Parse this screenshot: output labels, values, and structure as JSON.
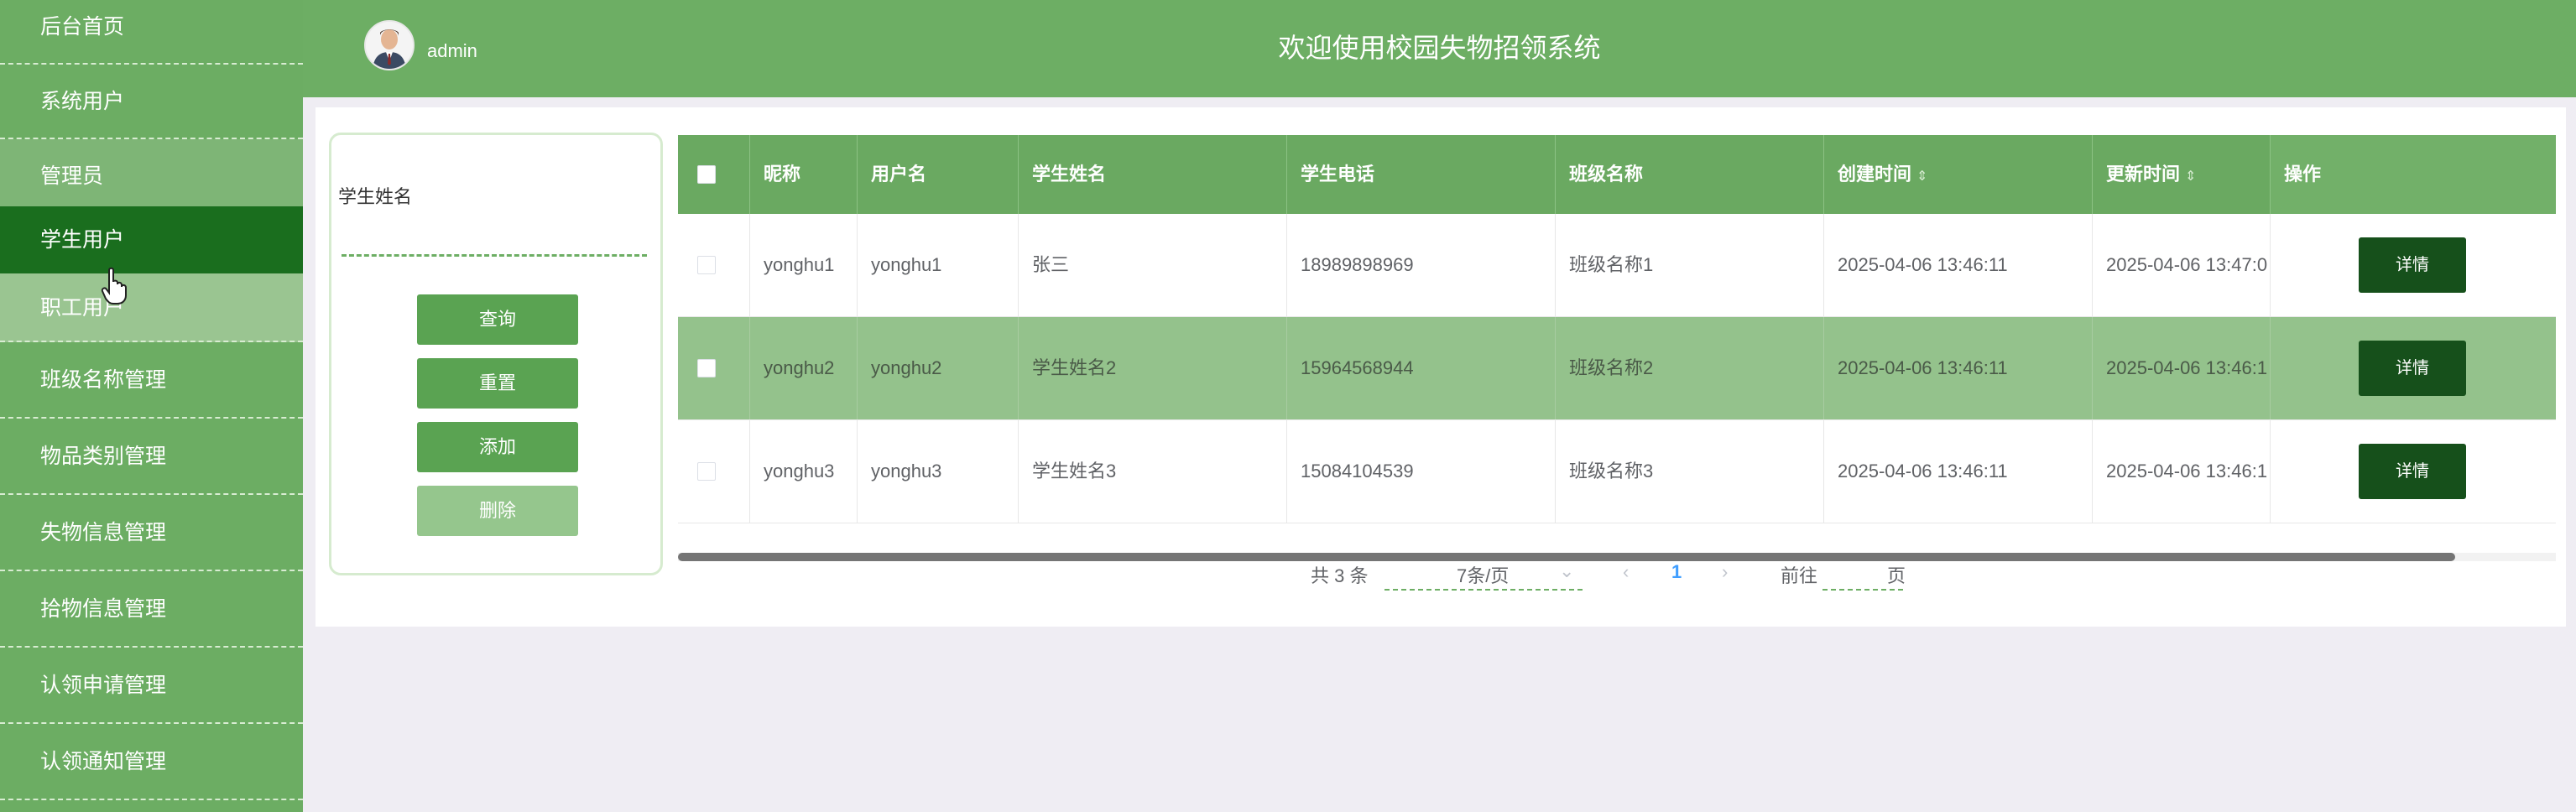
{
  "sidebar": {
    "items": [
      {
        "label": "后台首页"
      },
      {
        "label": "系统用户"
      },
      {
        "label": "管理员"
      },
      {
        "label": "学生用户"
      },
      {
        "label": "职工用户"
      },
      {
        "label": "班级名称管理"
      },
      {
        "label": "物品类别管理"
      },
      {
        "label": "失物信息管理"
      },
      {
        "label": "拾物信息管理"
      },
      {
        "label": "认领申请管理"
      },
      {
        "label": "认领通知管理"
      }
    ]
  },
  "header": {
    "username": "admin",
    "title": "欢迎使用校园失物招领系统"
  },
  "search": {
    "label": "学生姓名",
    "value": "",
    "placeholder": "",
    "buttons": {
      "query": "查询",
      "reset": "重置",
      "add": "添加",
      "delete": "删除"
    }
  },
  "table": {
    "columns": {
      "nickname": "昵称",
      "username": "用户名",
      "student_name": "学生姓名",
      "phone": "学生电话",
      "class_name": "班级名称",
      "created": "创建时间",
      "updated": "更新时间",
      "actions": "操作"
    },
    "rows": [
      {
        "nickname": "yonghu1",
        "username": "yonghu1",
        "student_name": "张三",
        "phone": "18989898969",
        "class_name": "班级名称1",
        "created": "2025-04-06 13:46:11",
        "updated": "2025-04-06 13:47:0",
        "action": "详情"
      },
      {
        "nickname": "yonghu2",
        "username": "yonghu2",
        "student_name": "学生姓名2",
        "phone": "15964568944",
        "class_name": "班级名称2",
        "created": "2025-04-06 13:46:11",
        "updated": "2025-04-06 13:46:1",
        "action": "详情"
      },
      {
        "nickname": "yonghu3",
        "username": "yonghu3",
        "student_name": "学生姓名3",
        "phone": "15084104539",
        "class_name": "班级名称3",
        "created": "2025-04-06 13:46:11",
        "updated": "2025-04-06 13:46:1",
        "action": "详情"
      }
    ]
  },
  "pagination": {
    "total": "共 3 条",
    "page_size": "7条/页",
    "current_page": "1",
    "goto_label": "前往",
    "page_unit": "页",
    "prev_icon": "chevron-left",
    "next_icon": "chevron-right"
  },
  "colors": {
    "primary": "#6dae64",
    "active": "#1a6e1e",
    "detail_button": "#16501b"
  }
}
